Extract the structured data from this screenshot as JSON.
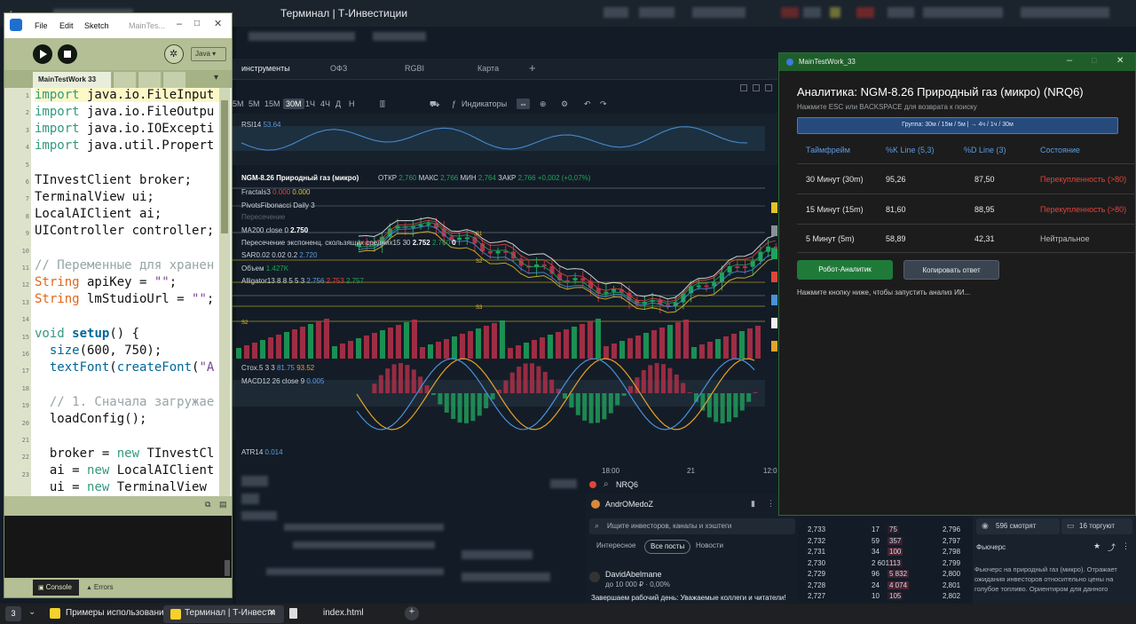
{
  "terminal": {
    "title": "Терминал | Т-Инвестиции",
    "tabs": [
      "инструменты",
      "ОФЗ",
      "RGBI",
      "Карта"
    ],
    "add_tab": "+",
    "timeframes": [
      "5М",
      "15М",
      "30М",
      "1Ч",
      "4Ч",
      "Д",
      "Н"
    ],
    "active_timeframe": "30М",
    "indicators_label": "Индикаторы",
    "chart": {
      "rsi_label": "RSI14",
      "rsi_value": "53.64",
      "instrument_title": "NGM-8.26 Природный газ (микро)",
      "ohlc_open_label": "ОТКР",
      "ohlc_open": "2,760",
      "ohlc_high_label": "МАКС",
      "ohlc_high": "2,766",
      "ohlc_low_label": "МИН",
      "ohlc_low": "2,764",
      "ohlc_close_label": "ЗАКР",
      "ohlc_close": "2,766",
      "ohlc_change": "+0,002 (+0,07%)",
      "fractals_label": "Fractals3",
      "fractals_value": "0.000",
      "pivots_label": "PivotsFibonacci Daily 3",
      "cross_label": "Пересечение",
      "ma_label": "MA200 close 0",
      "ma_value": "2.750",
      "ema_cross_label": "Пересечение экспоненц. скользящих средних15 30",
      "ema_cross_v1": "2.752",
      "ema_cross_v2": "2.760",
      "ema_cross_v3": "0",
      "sar_label": "SAR0.02 0.02 0.2",
      "sar_value": "2.720",
      "volume_label": "Объем",
      "volume_value": "1.427K",
      "alligator_label": "Alligator13 8 8 5 5 3",
      "alligator_v1": "2.756",
      "alligator_v2": "2.753",
      "alligator_v3": "2.757",
      "level_s1": "S1",
      "level_s2": "S2",
      "level_s3": "S3",
      "stoch_label": "Стох.5 3 3",
      "stoch_v1": "81.75",
      "stoch_v2": "93.52",
      "macd_label": "MACD12 26 close 9",
      "macd_value": "0.005",
      "atr_label": "ATR14",
      "atr_value": "0.014",
      "time_labels": [
        "18:00",
        "21",
        "12:0"
      ]
    },
    "search_text": "NRQ6",
    "feed": {
      "user": "AndrOMedoZ",
      "search_placeholder": "Ищите инвесторов, каналы и хэштеги",
      "tabs": [
        "Интересное",
        "Все посты",
        "Новости"
      ],
      "active_tab": "Все посты",
      "post_author": "DavidAbelmane",
      "post_meta": "до 10 000 ₽ · 0,00%",
      "post_text": "Завершаем рабочий день: Уважаемые коллеги и читатели!"
    },
    "orderbook": [
      {
        "price": "2,733",
        "v1": "17",
        "v2": "75",
        "ask": "2,796"
      },
      {
        "price": "2,732",
        "v1": "59",
        "v2": "357",
        "ask": "2,797"
      },
      {
        "price": "2,731",
        "v1": "34",
        "v2": "100",
        "ask": "2,798"
      },
      {
        "price": "2,730",
        "v1": "2 601",
        "v2": "113",
        "ask": "2,799"
      },
      {
        "price": "2,729",
        "v1": "96",
        "v2": "5 832",
        "ask": "2,800"
      },
      {
        "price": "2,728",
        "v1": "24",
        "v2": "4 074",
        "ask": "2,801"
      },
      {
        "price": "2,727",
        "v1": "10",
        "v2": "105",
        "ask": "2,802"
      }
    ],
    "right_panel": {
      "watching": "596 смотрят",
      "trading": "16 торгуют",
      "section_title": "Фьючерс",
      "description": "Фьючерс на природный газ (микро). Отражает ожидания инвесторов относительно цены на голубое топливо. Ориентиром для данного"
    }
  },
  "ide": {
    "menu": [
      "File",
      "Edit",
      "Sketch"
    ],
    "window_title": "MainTes...",
    "mode": "Java ▾",
    "tab_name": "MainTestWork 33",
    "console_tab": "Console",
    "errors_tab": "Errors",
    "line_numbers": [
      "1",
      "2",
      "3",
      "4",
      "5",
      "6",
      "7",
      "8",
      "9",
      "10",
      "11",
      "12",
      "13",
      "14",
      "15",
      "16",
      "17",
      "18",
      "19",
      "20",
      "21",
      "22",
      "23"
    ]
  },
  "analytics": {
    "window_title": "MainTestWork_33",
    "heading": "Аналитика: NGM-8.26 Природный газ (микро) (NRQ6)",
    "hint": "Нажмите ESC или BACKSPACE для возврата к поиску",
    "group_label": "Группа: 30м / 15м / 5м   |   → 4ч / 1ч / 30м",
    "columns": [
      "Таймфрейм",
      "%K Line (5,3)",
      "%D Line (3)",
      "Состояние"
    ],
    "rows": [
      {
        "tf": "30 Минут (30m)",
        "k": "95,26",
        "d": "87,50",
        "state": "Перекупленность (>80)",
        "state_color": "#e0443c"
      },
      {
        "tf": "15 Минут (15m)",
        "k": "81,60",
        "d": "88,95",
        "state": "Перекупленность (>80)",
        "state_color": "#e0443c"
      },
      {
        "tf": "5 Минут (5m)",
        "k": "58,89",
        "d": "42,31",
        "state": "Нейтральное",
        "state_color": "#b9bdc1"
      }
    ],
    "robot_button": "Робот-Аналитик",
    "copy_button": "Копировать ответ",
    "footer_hint": "Нажмите кнопку ниже, чтобы запустить анализ ИИ..."
  },
  "taskbar": {
    "badge": "3",
    "items": [
      "Примеры использовани",
      "Терминал | Т-Инвести",
      "index.html"
    ],
    "close": "✕",
    "add": "+"
  },
  "colors": {
    "up": "#1fa35c",
    "down": "#b7304a",
    "accent_blue": "#5e9be0",
    "overbought": "#e0443c"
  }
}
